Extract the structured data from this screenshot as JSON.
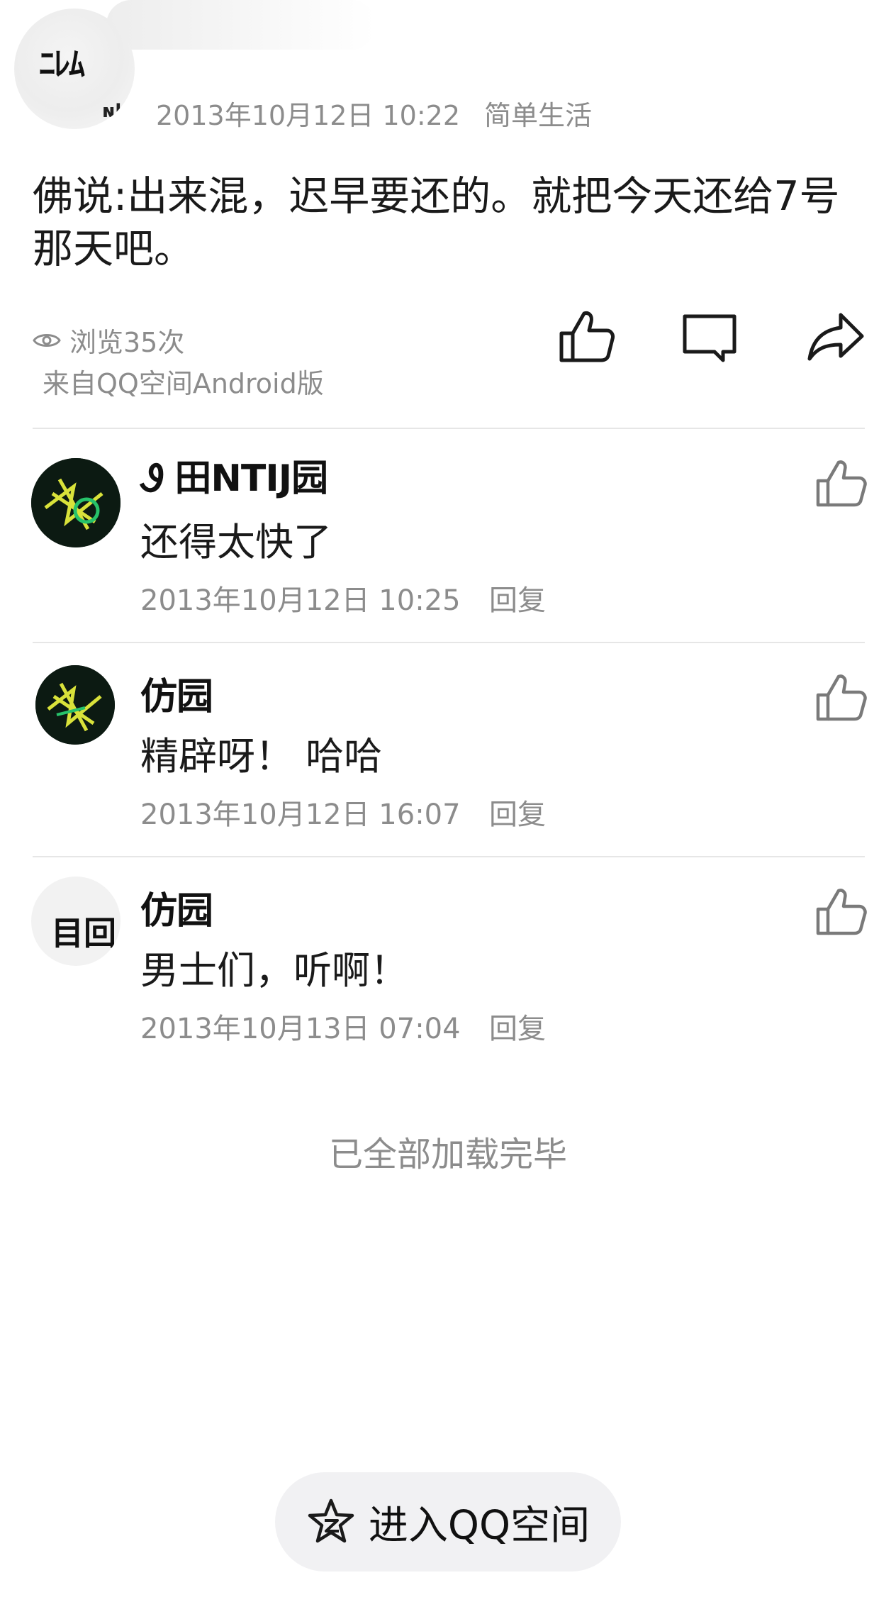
{
  "post": {
    "avatar_glyph": "ﾆﾚﾑ",
    "avatar_mini": "ɴk",
    "timestamp": "2013年10月12日 10:22",
    "category": "简单生活",
    "body": "佛说:出来混，迟早要还的。就把今天还给7号那天吧。",
    "views": "浏览35次",
    "source": "来自QQ空间Android版"
  },
  "comments": [
    {
      "name": "Ꮽ 田NTIJ园",
      "text": "还得太快了",
      "time": "2013年10月12日 10:25",
      "reply": "回复"
    },
    {
      "name": "仿园",
      "text": "精辟呀！ 哈哈",
      "time": "2013年10月12日 16:07",
      "reply": "回复"
    },
    {
      "name": "仿园",
      "avatar_glyph": "目回",
      "text": "男士们，听啊！",
      "time": "2013年10月13日 07:04",
      "reply": "回复"
    }
  ],
  "footer": {
    "loaded_text": "已全部加载完毕",
    "enter_button": "进入QQ空间"
  }
}
